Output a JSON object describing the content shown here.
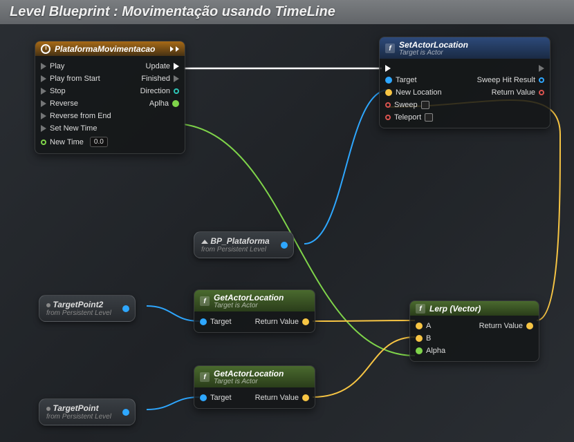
{
  "title": "Level Blueprint : Movimentação usando TimeLine",
  "timeline": {
    "title": "PlataformaMovimentacao",
    "inputs": [
      "Play",
      "Play from Start",
      "Stop",
      "Reverse",
      "Reverse from End",
      "Set New Time"
    ],
    "new_time_label": "New Time",
    "new_time_value": "0.0",
    "outputs": {
      "update": "Update",
      "finished": "Finished",
      "direction": "Direction",
      "alpha": "Aplha"
    }
  },
  "setActor": {
    "title": "SetActorLocation",
    "subtitle": "Target is Actor",
    "target": "Target",
    "new_loc": "New Location",
    "sweep": "Sweep",
    "teleport": "Teleport",
    "sweep_hit": "Sweep Hit Result",
    "return": "Return Value"
  },
  "getActor1": {
    "title": "GetActorLocation",
    "subtitle": "Target is Actor",
    "target": "Target",
    "return": "Return Value"
  },
  "getActor2": {
    "title": "GetActorLocation",
    "subtitle": "Target is Actor",
    "target": "Target",
    "return": "Return Value"
  },
  "lerp": {
    "title": "Lerp (Vector)",
    "a": "A",
    "b": "B",
    "alpha": "Alpha",
    "return": "Return Value"
  },
  "refs": {
    "bp": {
      "name": "BP_Plataforma",
      "sub": "from Persistent Level"
    },
    "tp2": {
      "name": "TargetPoint2",
      "sub": "from Persistent Level"
    },
    "tp": {
      "name": "TargetPoint",
      "sub": "from Persistent Level"
    }
  }
}
